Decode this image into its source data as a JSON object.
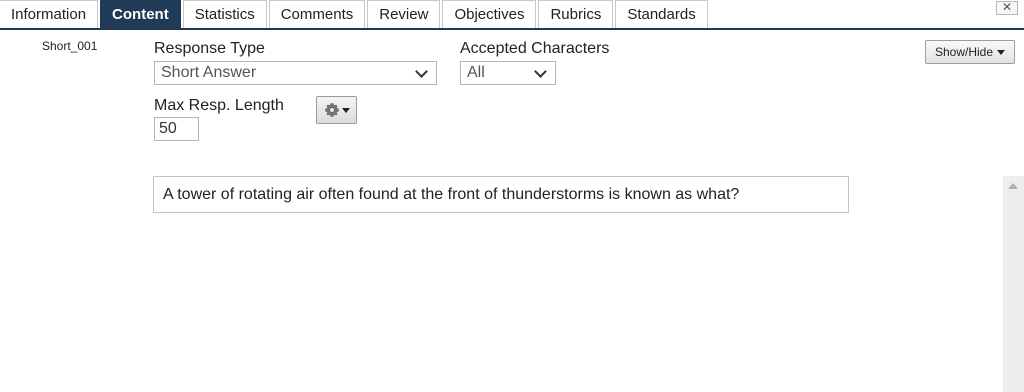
{
  "tabs": [
    {
      "label": "Information",
      "active": false
    },
    {
      "label": "Content",
      "active": true
    },
    {
      "label": "Statistics",
      "active": false
    },
    {
      "label": "Comments",
      "active": false
    },
    {
      "label": "Review",
      "active": false
    },
    {
      "label": "Objectives",
      "active": false
    },
    {
      "label": "Rubrics",
      "active": false
    },
    {
      "label": "Standards",
      "active": false
    }
  ],
  "close_icon": "close-icon",
  "item_id": "Short_001",
  "response_type": {
    "label": "Response Type",
    "value": "Short Answer"
  },
  "accepted_characters": {
    "label": "Accepted Characters",
    "value": "All"
  },
  "max_length": {
    "label": "Max Resp. Length",
    "value": "50"
  },
  "settings_button": {
    "icon": "gear-icon"
  },
  "show_hide": {
    "label": "Show/Hide"
  },
  "question_text": "A tower of rotating air often found at the front of thunderstorms is known as what?",
  "colors": {
    "active_tab": "#1f3b57",
    "border": "#c4c4c4",
    "scrollbar": "#eeeeee"
  }
}
